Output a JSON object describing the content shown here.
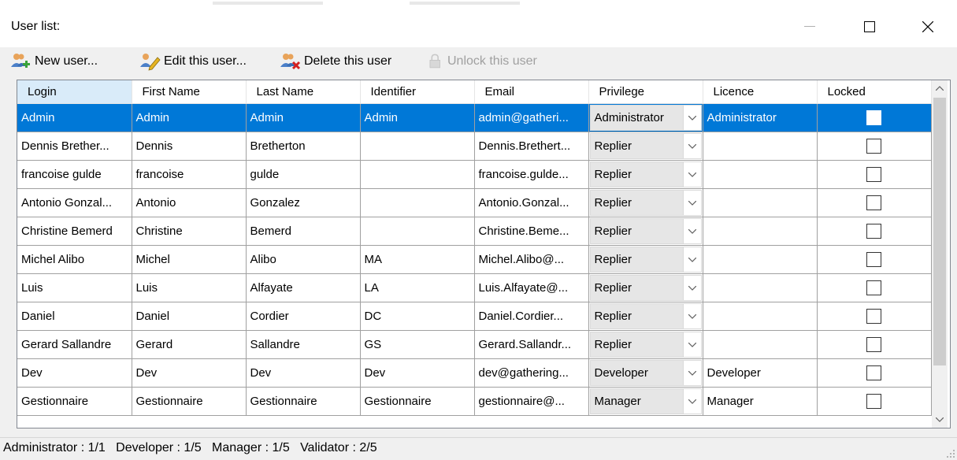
{
  "window": {
    "title": "User list:"
  },
  "toolbar": {
    "new_user": {
      "label": "New user...",
      "icon": "user-add-icon"
    },
    "edit_user": {
      "label": "Edit this user...",
      "icon": "user-edit-icon"
    },
    "delete_user": {
      "label": "Delete this user",
      "icon": "user-delete-icon"
    },
    "unlock_user": {
      "label": "Unlock this user",
      "icon": "lock-icon"
    }
  },
  "table": {
    "columns": [
      "Login",
      "First Name",
      "Last Name",
      "Identifier",
      "Email",
      "Privilege",
      "Licence",
      "Locked"
    ],
    "rows": [
      {
        "login": "Admin",
        "first": "Admin",
        "last": "Admin",
        "identifier": "Admin",
        "email": "admin@gatheri...",
        "privilege": "Administrator",
        "licence": "Administrator",
        "locked": false,
        "selected": true
      },
      {
        "login": "Dennis Brether...",
        "first": "Dennis",
        "last": "Bretherton",
        "identifier": "",
        "email": "Dennis.Brethert...",
        "privilege": "Replier",
        "licence": "",
        "locked": false
      },
      {
        "login": "francoise gulde",
        "first": "francoise",
        "last": "gulde",
        "identifier": "",
        "email": "francoise.gulde...",
        "privilege": "Replier",
        "licence": "",
        "locked": false
      },
      {
        "login": "Antonio Gonzal...",
        "first": "Antonio",
        "last": "Gonzalez",
        "identifier": "",
        "email": "Antonio.Gonzal...",
        "privilege": "Replier",
        "licence": "",
        "locked": false
      },
      {
        "login": "Christine Bemerd",
        "first": "Christine",
        "last": "Bemerd",
        "identifier": "",
        "email": "Christine.Beme...",
        "privilege": "Replier",
        "licence": "",
        "locked": false
      },
      {
        "login": "Michel Alibo",
        "first": "Michel",
        "last": "Alibo",
        "identifier": "MA",
        "email": "Michel.Alibo@...",
        "privilege": "Replier",
        "licence": "",
        "locked": false
      },
      {
        "login": "Luis",
        "first": "Luis",
        "last": "Alfayate",
        "identifier": "LA",
        "email": "Luis.Alfayate@...",
        "privilege": "Replier",
        "licence": "",
        "locked": false
      },
      {
        "login": "Daniel",
        "first": "Daniel",
        "last": "Cordier",
        "identifier": "DC",
        "email": "Daniel.Cordier...",
        "privilege": "Replier",
        "licence": "",
        "locked": false
      },
      {
        "login": "Gerard Sallandre",
        "first": "Gerard",
        "last": "Sallandre",
        "identifier": "GS",
        "email": "Gerard.Sallandr...",
        "privilege": "Replier",
        "licence": "",
        "locked": false
      },
      {
        "login": "Dev",
        "first": "Dev",
        "last": "Dev",
        "identifier": "Dev",
        "email": "dev@gathering...",
        "privilege": "Developer",
        "licence": "Developer",
        "locked": false
      },
      {
        "login": "Gestionnaire",
        "first": "Gestionnaire",
        "last": "Gestionnaire",
        "identifier": "Gestionnaire",
        "email": "gestionnaire@...",
        "privilege": "Manager",
        "licence": "Manager",
        "locked": false
      }
    ]
  },
  "status": {
    "text": "Administrator : 1/1   Developer : 1/5   Manager : 1/5   Validator : 2/5"
  },
  "colors": {
    "selection": "#0078d7",
    "sorted_header": "#d9ebf9"
  }
}
